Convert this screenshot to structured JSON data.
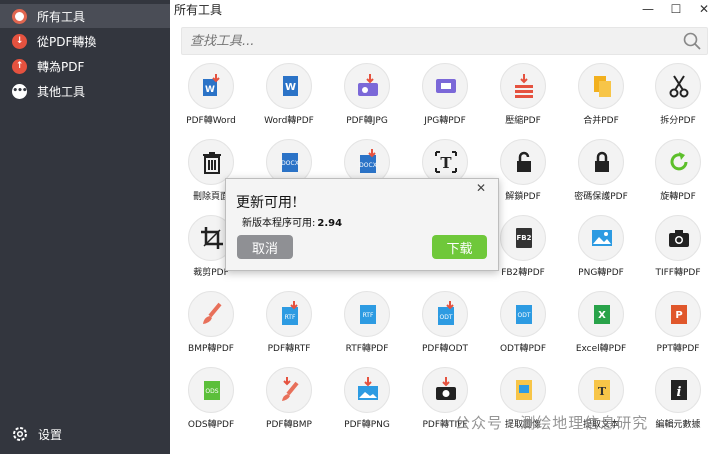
{
  "window": {
    "title": "所有工具"
  },
  "sidebar": {
    "items": [
      {
        "label": "所有工具",
        "icon": "target-icon",
        "active": true
      },
      {
        "label": "從PDF轉換",
        "icon": "arrow-down-icon"
      },
      {
        "label": "轉為PDF",
        "icon": "arrow-up-icon"
      },
      {
        "label": "其他工具",
        "icon": "more-icon"
      }
    ],
    "settings_label": "设置"
  },
  "search": {
    "placeholder": "查找工具..."
  },
  "tools": [
    {
      "label": "PDF轉Word",
      "icon": "pdf-to-word-icon"
    },
    {
      "label": "Word轉PDF",
      "icon": "word-to-pdf-icon"
    },
    {
      "label": "PDF轉JPG",
      "icon": "pdf-to-jpg-icon"
    },
    {
      "label": "JPG轉PDF",
      "icon": "jpg-to-pdf-icon"
    },
    {
      "label": "壓縮PDF",
      "icon": "compress-icon"
    },
    {
      "label": "合并PDF",
      "icon": "merge-icon"
    },
    {
      "label": "拆分PDF",
      "icon": "scissors-icon"
    },
    {
      "label": "刪除頁面",
      "icon": "trash-icon"
    },
    {
      "label": "",
      "icon": "docx-icon"
    },
    {
      "label": "",
      "icon": "docx-to-pdf-icon"
    },
    {
      "label": "",
      "icon": "text-icon"
    },
    {
      "label": "解鎖PDF",
      "icon": "unlock-icon"
    },
    {
      "label": "密碼保護PDF",
      "icon": "lock-icon"
    },
    {
      "label": "旋轉PDF",
      "icon": "rotate-icon"
    },
    {
      "label": "裁剪PDF",
      "icon": "crop-icon"
    },
    {
      "label": "",
      "icon": "hidden-tool-icon"
    },
    {
      "label": "",
      "icon": "hidden-tool-icon"
    },
    {
      "label": "",
      "icon": "hidden-tool-icon"
    },
    {
      "label": "FB2轉PDF",
      "icon": "fb2-icon"
    },
    {
      "label": "PNG轉PDF",
      "icon": "image-icon"
    },
    {
      "label": "TIFF轉PDF",
      "icon": "camera-icon"
    },
    {
      "label": "BMP轉PDF",
      "icon": "brush-icon"
    },
    {
      "label": "PDF轉RTF",
      "icon": "pdf-to-rtf-icon"
    },
    {
      "label": "RTF轉PDF",
      "icon": "rtf-to-pdf-icon"
    },
    {
      "label": "PDF轉ODT",
      "icon": "pdf-to-odt-icon"
    },
    {
      "label": "ODT轉PDF",
      "icon": "odt-to-pdf-icon"
    },
    {
      "label": "Excel轉PDF",
      "icon": "excel-icon"
    },
    {
      "label": "PPT轉PDF",
      "icon": "powerpoint-icon"
    },
    {
      "label": "ODS轉PDF",
      "icon": "ods-icon"
    },
    {
      "label": "PDF轉BMP",
      "icon": "pdf-to-bmp-icon"
    },
    {
      "label": "PDF轉PNG",
      "icon": "pdf-to-png-icon"
    },
    {
      "label": "PDF轉TIFF",
      "icon": "pdf-to-tiff-icon"
    },
    {
      "label": "提取圖像",
      "icon": "extract-images-icon"
    },
    {
      "label": "提取文本",
      "icon": "extract-text-icon"
    },
    {
      "label": "編輯元數據",
      "icon": "info-icon"
    }
  ],
  "dialog": {
    "title": "更新可用!",
    "message": "新版本程序可用:",
    "version": "2.94",
    "cancel_label": "取消",
    "download_label": "下载"
  },
  "watermark": "公众号 · 测绘地理信息研究",
  "colors": {
    "sidebar": "#33363e",
    "accent_red": "#e5523f",
    "download_green": "#6fc83a",
    "cancel_gray": "#8f9094"
  }
}
